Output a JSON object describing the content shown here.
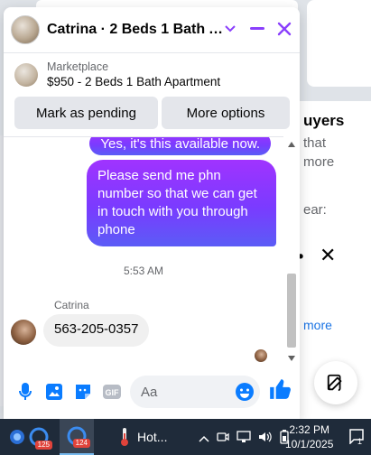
{
  "colors": {
    "accent": "#7a3bff",
    "messenger_blue": "#0a7cff",
    "header_icon_purple": "#8a3ffc"
  },
  "background": {
    "right_card_title": "uyers",
    "right_line1": "that",
    "right_line2": "more",
    "right_line3": "ear:",
    "right_more": "more"
  },
  "chat": {
    "title": "Catrina · 2 Beds 1 Bath Apa...",
    "icons": [
      "chevron-down-icon",
      "minimize-icon",
      "close-icon"
    ],
    "listing": {
      "source": "Marketplace",
      "title": "$950 - 2 Beds 1 Bath Apartment"
    },
    "actions": {
      "mark_pending": "Mark as pending",
      "more_options": "More options"
    },
    "messages": {
      "previous_out": "Yes, it's this available now.",
      "out": "Please send me  phn number so that we can get in touch with you through phone",
      "timestamp": "5:53 AM",
      "sender": "Catrina",
      "in": "563-205-0357"
    },
    "composer": {
      "placeholder": "Aa",
      "icons": [
        "microphone-icon",
        "photo-icon",
        "sticker-icon",
        "gif-icon",
        "emoji-icon",
        "like-icon"
      ],
      "gif_label": "GIF"
    }
  },
  "taskbar": {
    "badges": [
      "125",
      "124"
    ],
    "weather_label": "Hot...",
    "time": "2:32 PM",
    "date": "10/1/2025",
    "notification_count": "1"
  }
}
